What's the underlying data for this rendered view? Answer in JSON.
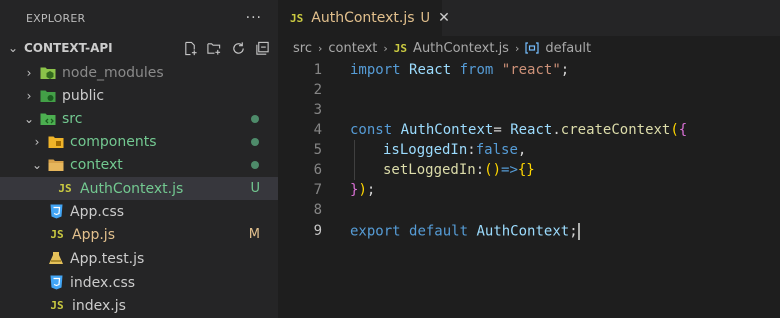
{
  "explorer": {
    "title": "EXPLORER",
    "more": "···",
    "section": "CONTEXT-API",
    "tree": [
      {
        "label": "node_modules",
        "kind": "folder",
        "chev": "›",
        "icon": "node-folder-icon",
        "color": "#8a8a8a",
        "status": ""
      },
      {
        "label": "public",
        "kind": "folder",
        "chev": "›",
        "icon": "public-folder-icon",
        "color": "#cccccc",
        "status": ""
      },
      {
        "label": "src",
        "kind": "folder",
        "chev": "⌄",
        "icon": "src-folder-icon",
        "color": "#73c991",
        "status": "dot"
      },
      {
        "label": "components",
        "kind": "folder",
        "chev": "›",
        "icon": "components-folder-icon",
        "color": "#73c991",
        "status": "dot"
      },
      {
        "label": "context",
        "kind": "folder",
        "chev": "⌄",
        "icon": "context-folder-icon",
        "color": "#73c991",
        "status": "dot"
      },
      {
        "label": "AuthContext.js",
        "kind": "file",
        "icon": "js-file-icon",
        "color": "#73c991",
        "status": "U"
      },
      {
        "label": "App.css",
        "kind": "file",
        "icon": "css-file-icon",
        "color": "#cccccc",
        "status": ""
      },
      {
        "label": "App.js",
        "kind": "file",
        "icon": "js-file-icon",
        "color": "#e2c08d",
        "status": "M"
      },
      {
        "label": "App.test.js",
        "kind": "file",
        "icon": "test-file-icon",
        "color": "#cccccc",
        "status": ""
      },
      {
        "label": "index.css",
        "kind": "file",
        "icon": "css-file-icon",
        "color": "#cccccc",
        "status": ""
      },
      {
        "label": "index.js",
        "kind": "file",
        "icon": "js-file-icon",
        "color": "#cccccc",
        "status": ""
      }
    ]
  },
  "tab": {
    "badge": "JS",
    "label": "AuthContext.js",
    "status": "U",
    "close": "✕"
  },
  "breadcrumb": {
    "src": "src",
    "context": "context",
    "badge": "JS",
    "file": "AuthContext.js",
    "symbol": "default",
    "sep": "›"
  },
  "code": {
    "line_numbers": [
      "1",
      "2",
      "3",
      "4",
      "5",
      "6",
      "7",
      "8",
      "9"
    ],
    "l1": {
      "kw": "import",
      "id": "React",
      "from": "from",
      "str": "\"react\"",
      "end": ";"
    },
    "l4": {
      "kw": "const",
      "id": "AuthContext",
      "eq": "=",
      "obj": "React",
      "dot": ".",
      "fn": "createContext",
      "p1": "(",
      "p2": "{"
    },
    "l5": {
      "prop": "isLoggedIn",
      "colon": ":",
      "val": "false",
      "comma": ","
    },
    "l6": {
      "prop": "setLoggedIn",
      "colon": ":",
      "parens": "()",
      "arrow": "=>",
      "braces": "{}"
    },
    "l7": {
      "c1": "}",
      "c2": ")",
      "semi": ";"
    },
    "l9": {
      "kw1": "export",
      "kw2": "default",
      "id": "AuthContext",
      "semi": ";"
    }
  }
}
